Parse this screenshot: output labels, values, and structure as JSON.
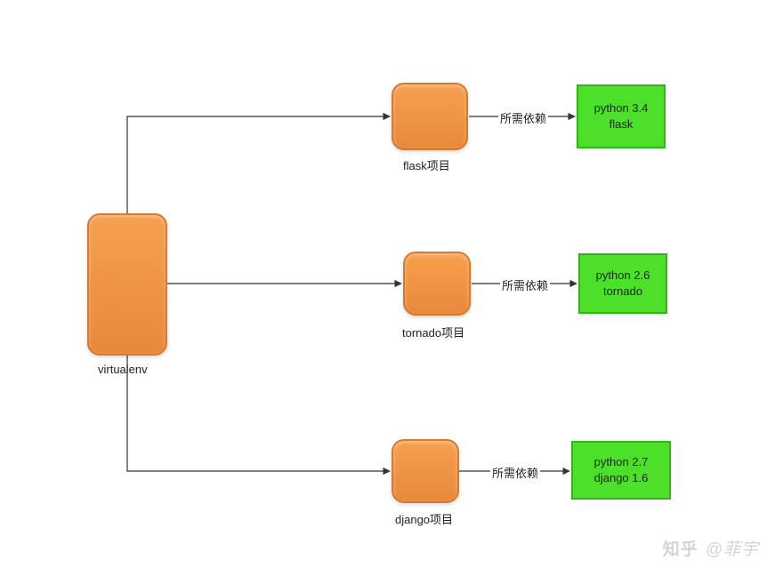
{
  "root": {
    "label": "virtualenv"
  },
  "projects": [
    {
      "caption": "flask项目",
      "edge_label": "所需依赖",
      "env": [
        "python 3.4",
        "flask"
      ]
    },
    {
      "caption": "tornado项目",
      "edge_label": "所需依赖",
      "env": [
        "python 2.6",
        "tornado"
      ]
    },
    {
      "caption": "django项目",
      "edge_label": "所需依赖",
      "env": [
        "python 2.7",
        "django 1.6"
      ]
    }
  ],
  "watermark": {
    "brand": "知乎",
    "at": "@菲宇"
  }
}
